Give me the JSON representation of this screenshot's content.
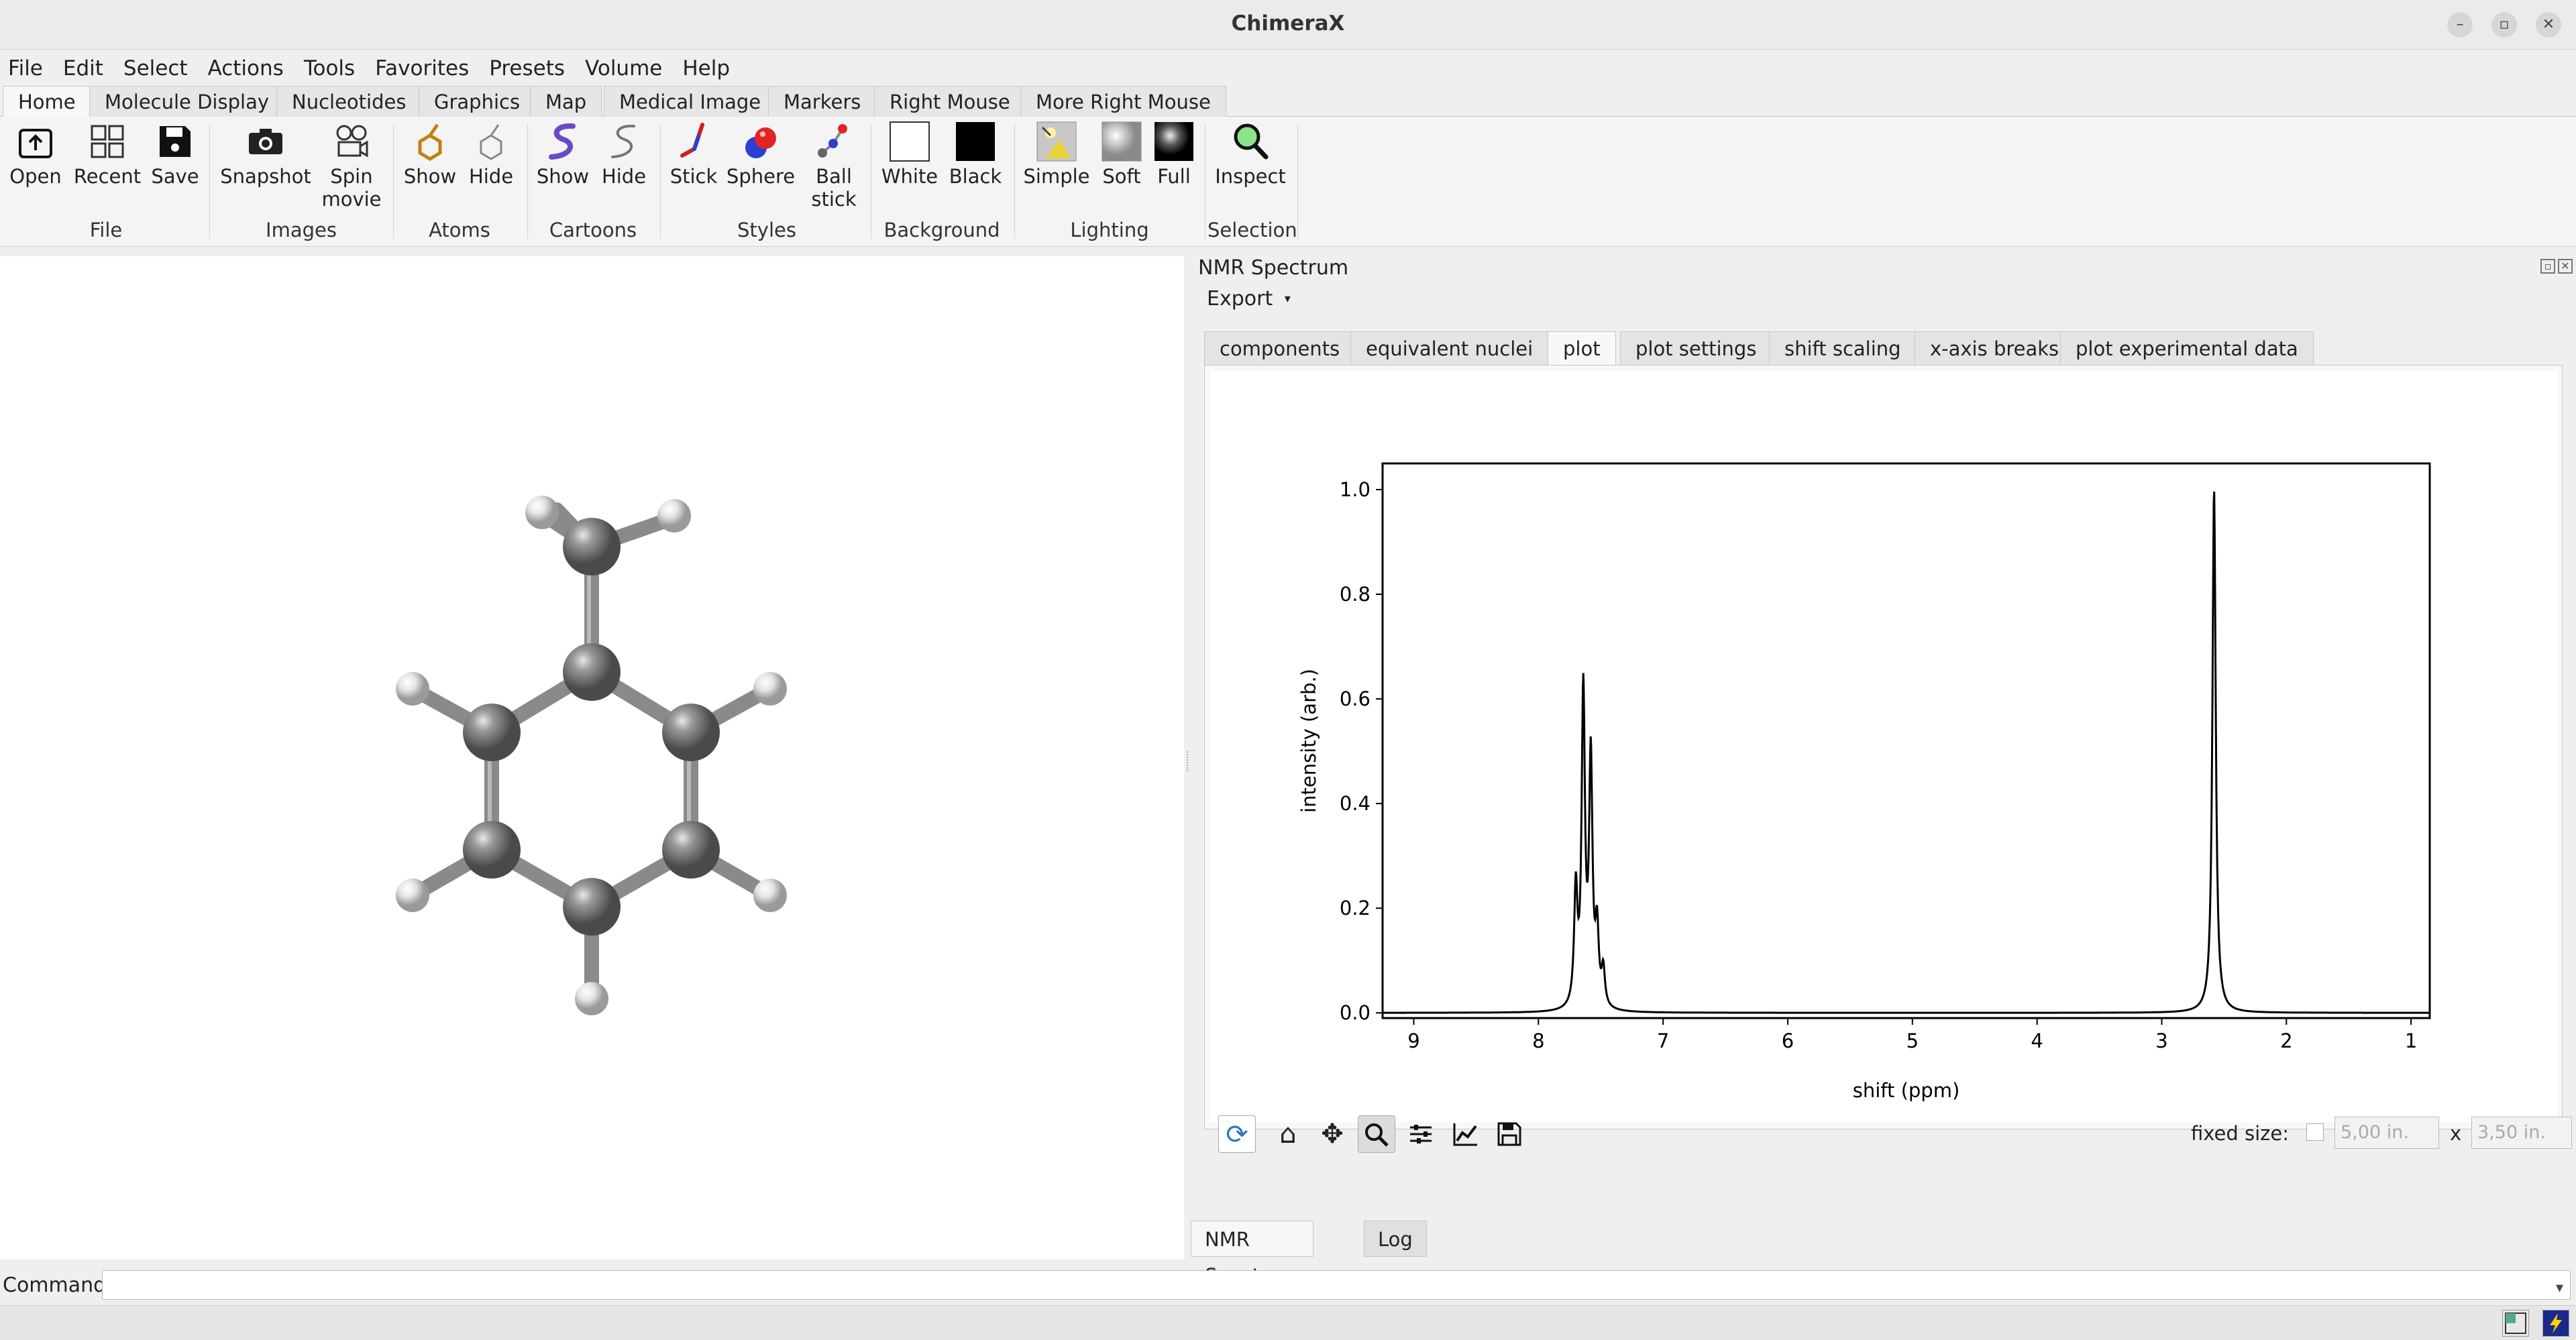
{
  "window": {
    "title": "ChimeraX"
  },
  "menu": [
    "File",
    "Edit",
    "Select",
    "Actions",
    "Tools",
    "Favorites",
    "Presets",
    "Volume",
    "Help"
  ],
  "ribbon_tabs": [
    "Home",
    "Molecule Display",
    "Nucleotides",
    "Graphics",
    "Map",
    "Medical Image",
    "Markers",
    "Right Mouse",
    "More Right Mouse"
  ],
  "ribbon": {
    "groups": {
      "file": "File",
      "images": "Images",
      "atoms": "Atoms",
      "cartoons": "Cartoons",
      "styles": "Styles",
      "background": "Background",
      "lighting": "Lighting",
      "selection": "Selection"
    },
    "buttons": {
      "open": "Open",
      "recent": "Recent",
      "save": "Save",
      "snapshot": "Snapshot",
      "spin_1": "Spin",
      "spin_2": "movie",
      "atoms_show": "Show",
      "atoms_hide": "Hide",
      "cartoons_show": "Show",
      "cartoons_hide": "Hide",
      "stick": "Stick",
      "sphere": "Sphere",
      "ball_1": "Ball",
      "ball_2": "stick",
      "white": "White",
      "black": "Black",
      "simple": "Simple",
      "soft": "Soft",
      "full": "Full",
      "inspect": "Inspect"
    }
  },
  "panel": {
    "title": "NMR Spectrum",
    "export": "Export",
    "tabs": [
      "components",
      "equivalent nuclei",
      "plot",
      "plot settings",
      "shift scaling",
      "x-axis breaks",
      "plot experimental data"
    ],
    "fixed_size_label": "fixed size:",
    "width_value": "5,00 in.",
    "x_sep": "x",
    "height_value": "3,50 in.",
    "bottom_tabs": [
      "NMR Spectrum",
      "Log"
    ]
  },
  "command": {
    "label": "Command:"
  },
  "chart_data": {
    "type": "line",
    "xlabel": "shift (ppm)",
    "ylabel": "intensity (arb.)",
    "xlim": [
      9.25,
      0.85
    ],
    "ylim": [
      -0.01,
      1.05
    ],
    "x_axis_reversed": true,
    "xticks": [
      9,
      8,
      7,
      6,
      5,
      4,
      3,
      2,
      1
    ],
    "yticks": [
      0.0,
      0.2,
      0.4,
      0.6,
      0.8,
      1.0
    ],
    "series": [
      {
        "color": "#000000",
        "peaks": [
          {
            "shift": 7.7,
            "intensity": 0.22
          },
          {
            "shift": 7.64,
            "intensity": 0.6
          },
          {
            "shift": 7.58,
            "intensity": 0.47
          },
          {
            "shift": 7.53,
            "intensity": 0.14
          },
          {
            "shift": 7.48,
            "intensity": 0.07
          },
          {
            "shift": 2.58,
            "intensity": 1.0
          }
        ]
      }
    ]
  }
}
